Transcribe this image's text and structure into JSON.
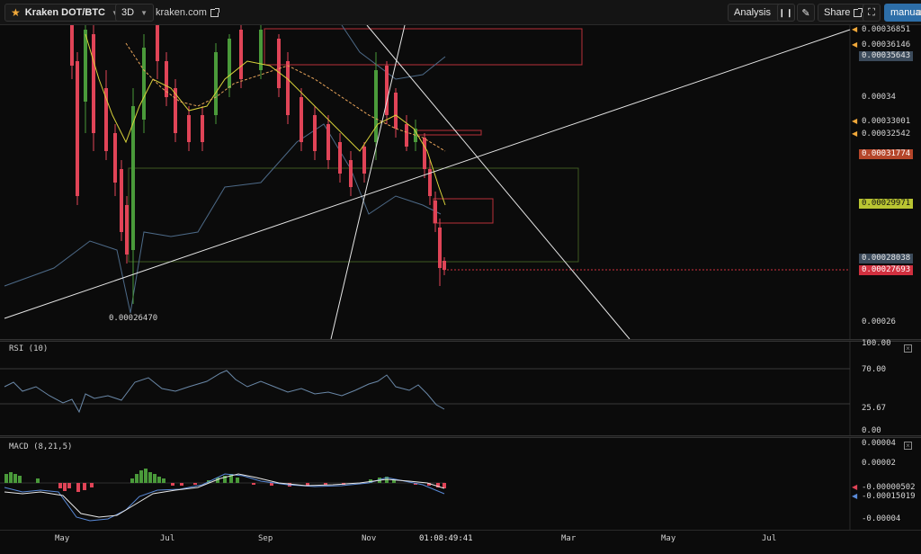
{
  "toolbar": {
    "symbol": "Kraken DOT/BTC",
    "timeframe": "3D",
    "source": "kraken.com",
    "analysis_label": "Analysis",
    "share_label": "Share",
    "mode_label": "manual",
    "mode_extra": "a"
  },
  "price_axis": {
    "tags": [
      {
        "label": "0.00036851",
        "kind": "arrow"
      },
      {
        "label": "0.00036146",
        "kind": "arrow"
      },
      {
        "label": "0.00035643",
        "kind": "tag",
        "color": "#3b4a5a"
      },
      {
        "label": "0.00034",
        "kind": "plain"
      },
      {
        "label": "0.00033001",
        "kind": "arrow"
      },
      {
        "label": "0.00032542",
        "kind": "arrow"
      },
      {
        "label": "0.00031774",
        "kind": "tag",
        "color": "#b5462a"
      },
      {
        "label": "0.00029971",
        "kind": "tag",
        "color": "#b9c432"
      },
      {
        "label": "0.00028038",
        "kind": "tag",
        "color": "#3b4a5a"
      },
      {
        "label": "0.00027693",
        "kind": "tag",
        "color": "#d1303f"
      },
      {
        "label": "0.00026",
        "kind": "plain"
      }
    ],
    "low_annotation": "0.00026470"
  },
  "rsi": {
    "title": "RSI (10)",
    "levels": [
      "100.00",
      "70.00",
      "25.67",
      "0.00"
    ]
  },
  "macd": {
    "title": "MACD (8,21,5)",
    "levels": [
      "0.00004",
      "0.00002",
      "-0.00000502",
      "-0.00015019",
      "-0.00004"
    ]
  },
  "time_axis": {
    "labels": [
      "May",
      "Jul",
      "Sep",
      "Nov",
      "Mar",
      "May",
      "Jul"
    ],
    "countdown": "01:08:49:41"
  },
  "colors": {
    "up": "#4a9a3a",
    "down": "#e04457",
    "accent": "#f0a83a",
    "manual": "#2d6ea8"
  }
}
